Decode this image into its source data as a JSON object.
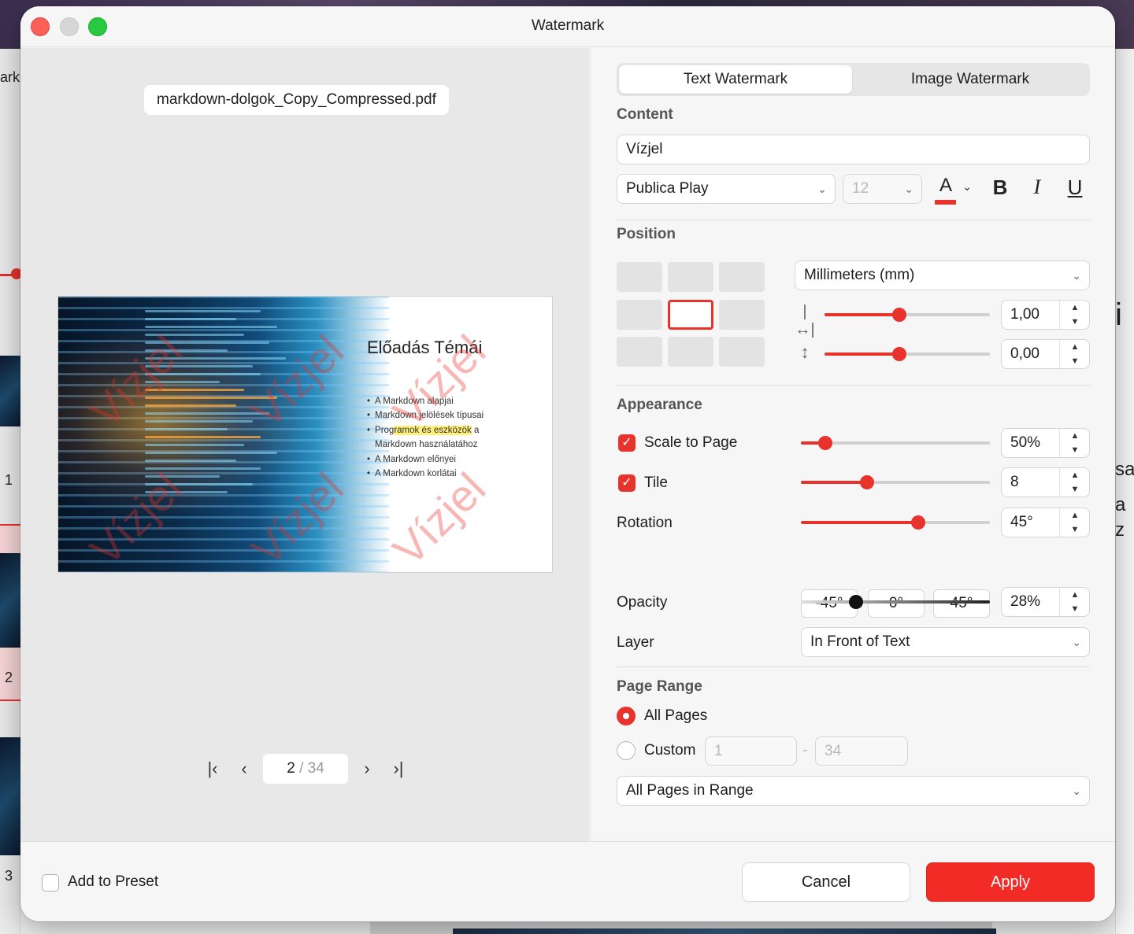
{
  "window": {
    "title": "Watermark"
  },
  "background": {
    "left_partial_text": "ark",
    "thumb_numbers": [
      "1",
      "2",
      "3"
    ],
    "right_partial_texts": [
      "i",
      "sa",
      "a",
      "z"
    ]
  },
  "preview": {
    "filename": "markdown-dolgok_Copy_Compressed.pdf",
    "slide": {
      "title": "Előadás Témái",
      "bullets": [
        "A Markdown alapjai",
        "Markdown jelölések típusai",
        "Programok és eszközök a Markdown használatához",
        "A Markdown előnyei",
        "A Markdown korlátai"
      ],
      "highlight_fragment": "ramok és eszközök",
      "watermark_text": "Vízjel"
    },
    "pager": {
      "current": "2",
      "separator": "/",
      "total": "34"
    }
  },
  "tabs": {
    "text": "Text Watermark",
    "image": "Image Watermark",
    "active": "text"
  },
  "content": {
    "label": "Content",
    "text_value": "Vízjel",
    "font": "Publica Play",
    "font_size": "12",
    "text_color": "#e8322c",
    "bold_label": "B",
    "italic_label": "I",
    "underline_label": "U",
    "color_label": "A"
  },
  "position": {
    "label": "Position",
    "selected_cell": "middle-center",
    "unit": "Millimeters (mm)",
    "horizontal_offset": "1,00",
    "vertical_offset": "0,00",
    "horizontal_slider_percent": 45,
    "vertical_slider_percent": 45
  },
  "appearance": {
    "label": "Appearance",
    "scale_to_page": {
      "label": "Scale to Page",
      "checked": true,
      "value": "50%",
      "slider_percent": 13
    },
    "tile": {
      "label": "Tile",
      "checked": true,
      "value": "8",
      "slider_percent": 35
    },
    "rotation": {
      "label": "Rotation",
      "value": "45°",
      "slider_percent": 62,
      "presets": [
        "-45°",
        "0°",
        "45°"
      ]
    },
    "opacity": {
      "label": "Opacity",
      "value": "28%",
      "slider_percent": 29
    },
    "layer": {
      "label": "Layer",
      "value": "In Front of Text"
    }
  },
  "page_range": {
    "label": "Page Range",
    "all_pages": "All Pages",
    "custom": "Custom",
    "custom_from": "1",
    "custom_dash": "-",
    "custom_to": "34",
    "selected": "all",
    "subset": "All Pages in Range"
  },
  "footer": {
    "add_to_preset": "Add to Preset",
    "cancel": "Cancel",
    "apply": "Apply"
  },
  "colors": {
    "accent": "#e8322c",
    "apply_button": "#f22b26"
  }
}
